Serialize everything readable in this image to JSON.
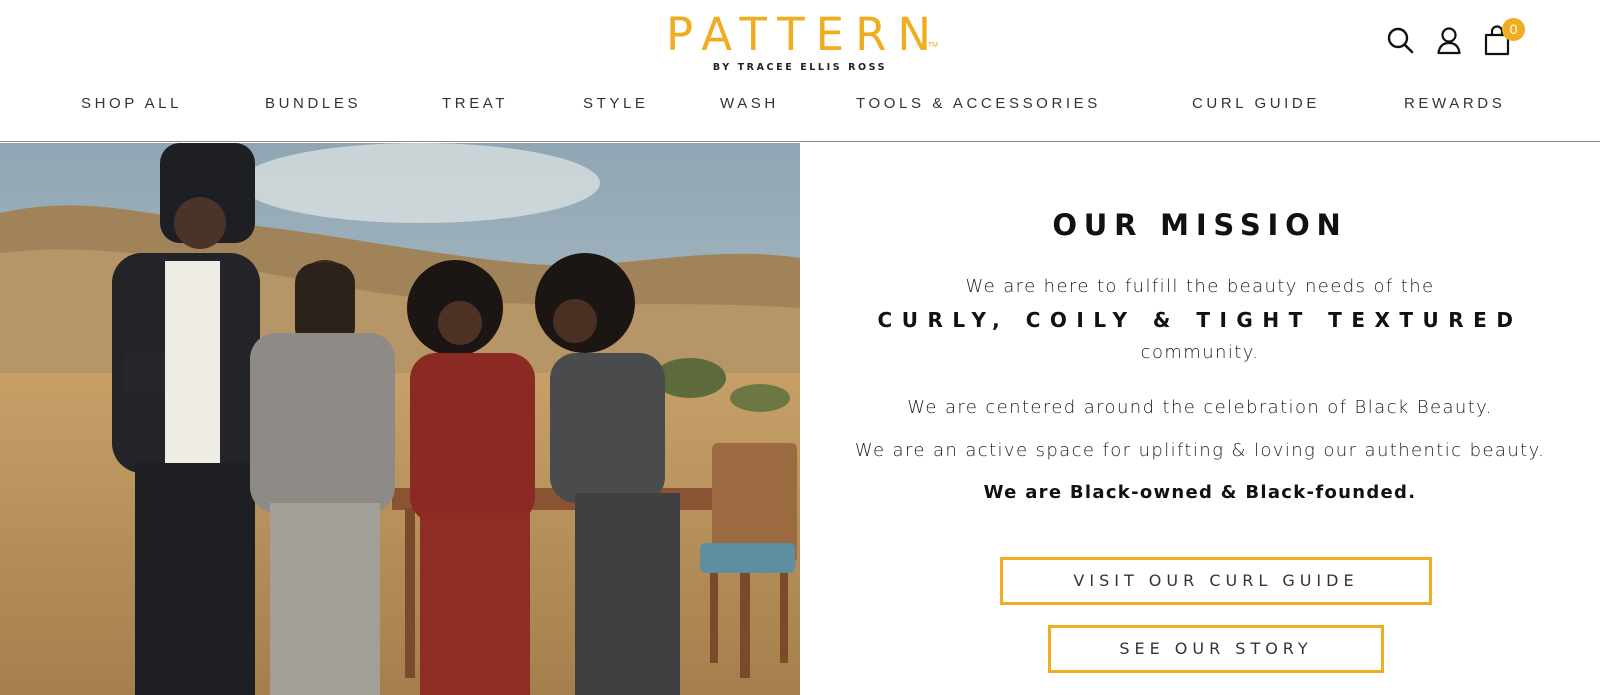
{
  "brand": {
    "name": "PATTERN",
    "tm": "TM",
    "tagline": "BY TRACEE ELLIS ROSS",
    "accent_color": "#f0ad1f"
  },
  "header_icons": {
    "search": "search-icon",
    "account": "account-icon",
    "cart": "shopping-bag-icon",
    "cart_count": "0"
  },
  "nav": {
    "items": [
      {
        "label": "SHOP ALL"
      },
      {
        "label": "BUNDLES"
      },
      {
        "label": "TREAT"
      },
      {
        "label": "STYLE"
      },
      {
        "label": "WASH"
      },
      {
        "label": "TOOLS & ACCESSORIES"
      },
      {
        "label": "CURL GUIDE"
      },
      {
        "label": "REWARDS"
      }
    ]
  },
  "mission": {
    "title": "OUR MISSION",
    "intro": "We are here to fulfill the beauty needs of the",
    "emphasis": "CURLY, COILY & TIGHT TEXTURED",
    "community": "community.",
    "line_centered": "We are centered around the celebration of Black Beauty.",
    "line_space": "We are an active space for uplifting & loving our authentic beauty.",
    "line_owned": "We are Black-owned & Black-founded.",
    "button_curl_guide": "VISIT OUR CURL GUIDE",
    "button_story": "SEE OUR STORY"
  }
}
